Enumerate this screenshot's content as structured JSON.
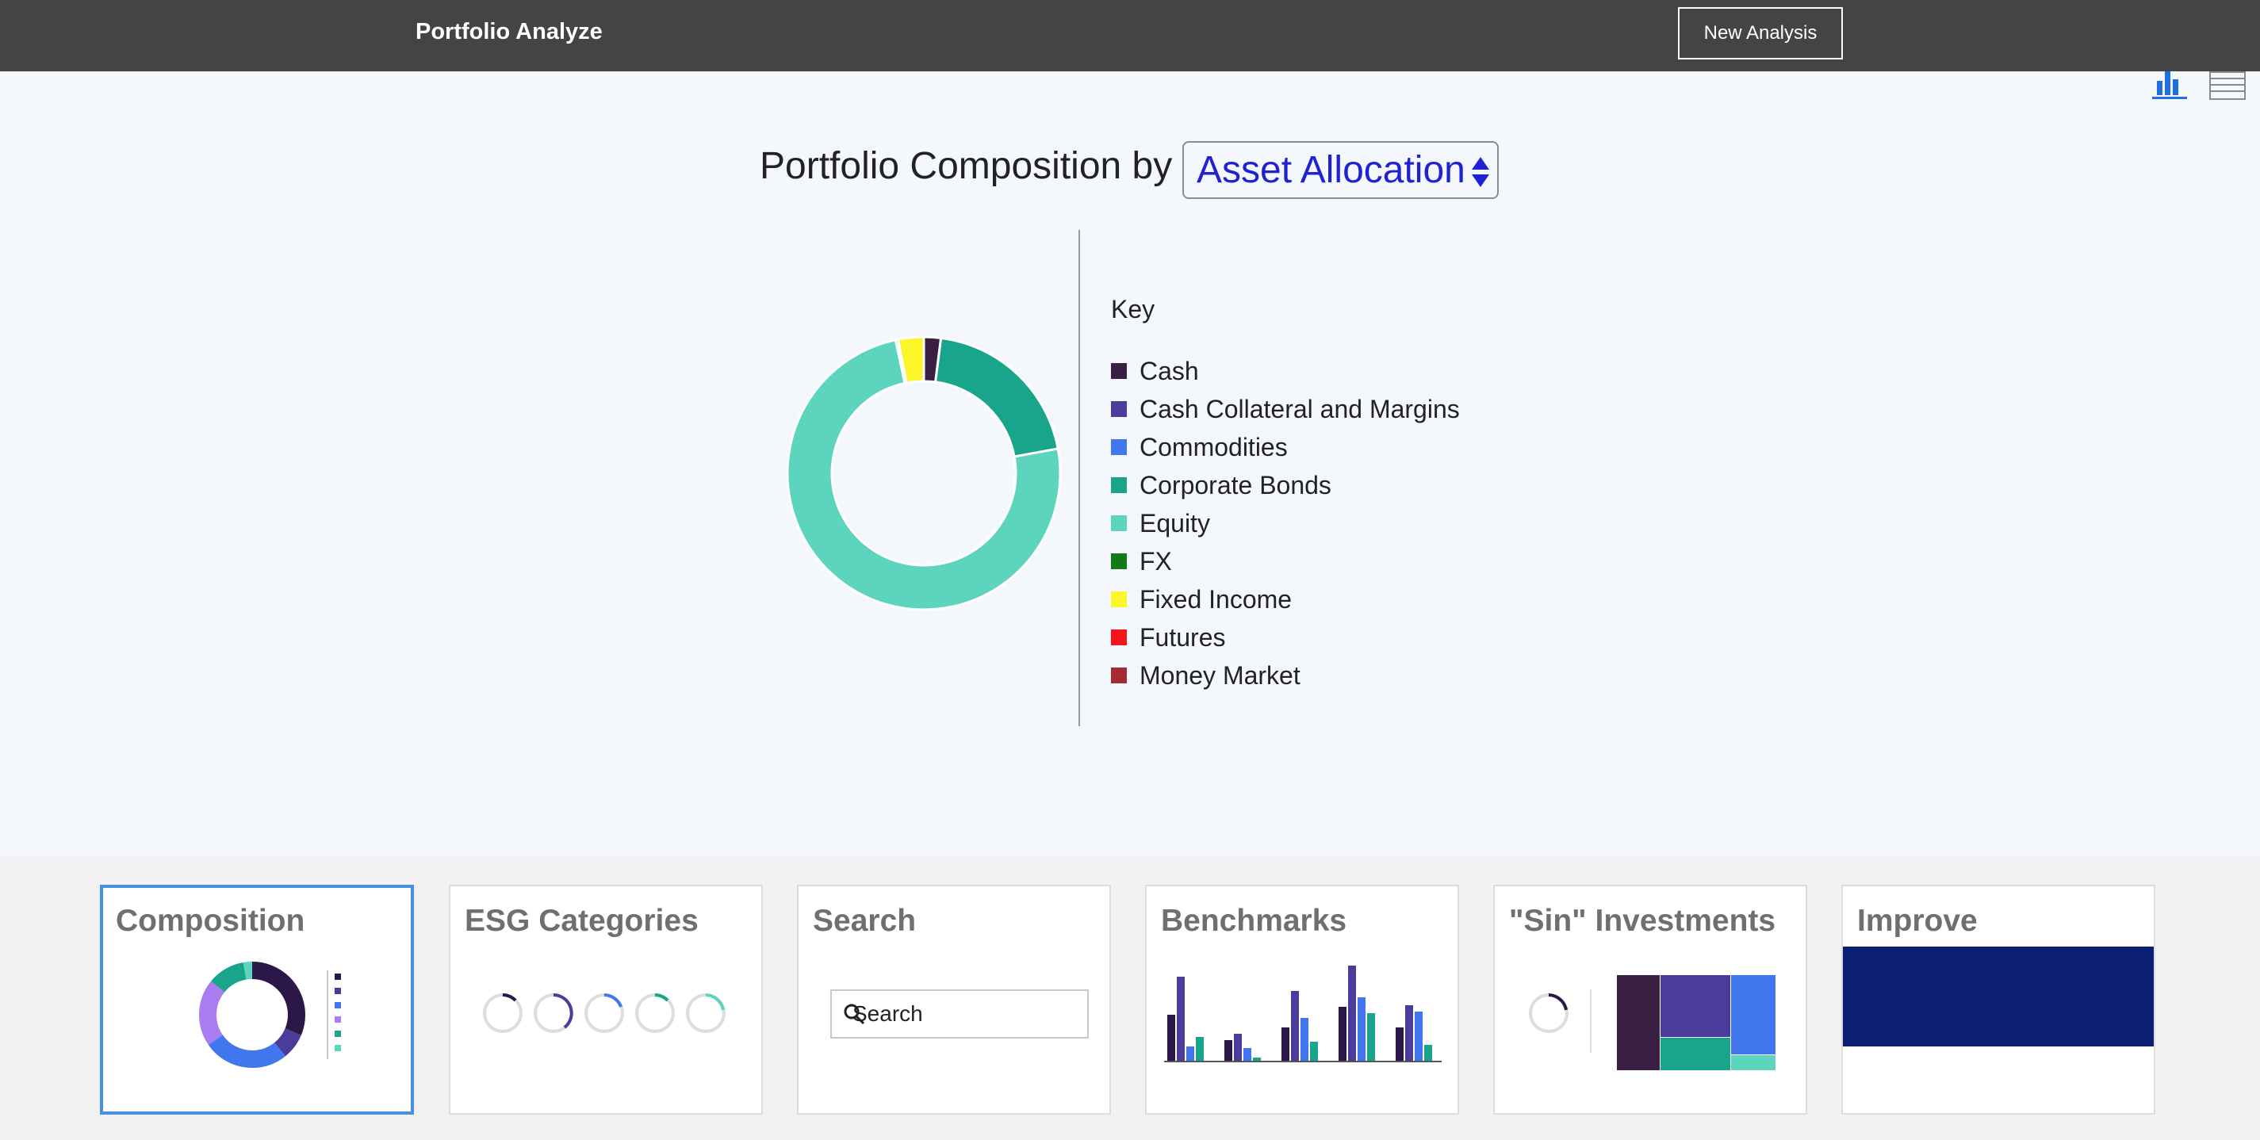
{
  "header": {
    "app_title": "Portfolio Analyze",
    "new_analysis_label": "New Analysis"
  },
  "view_toggle": {
    "chart_icon": "bar-chart-icon",
    "table_icon": "table-list-icon",
    "active": "chart"
  },
  "main": {
    "heading": "Portfolio Composition by",
    "selector_value": "Asset Allocation",
    "key_title": "Key"
  },
  "legend": [
    {
      "label": "Cash",
      "color": "#3a1f44"
    },
    {
      "label": "Cash Collateral and Margins",
      "color": "#4b3c9c"
    },
    {
      "label": "Commodities",
      "color": "#4176ee"
    },
    {
      "label": "Corporate Bonds",
      "color": "#18a58c"
    },
    {
      "label": "Equity",
      "color": "#5dd4bd"
    },
    {
      "label": "FX",
      "color": "#0f7a17"
    },
    {
      "label": "Fixed Income",
      "color": "#fbf52a"
    },
    {
      "label": "Futures",
      "color": "#f5131b"
    },
    {
      "label": "Money Market",
      "color": "#a52b32"
    }
  ],
  "chart_data": {
    "type": "pie",
    "donut": true,
    "slices": [
      {
        "label": "Cash",
        "value": 2.0,
        "color": "#3a1f44"
      },
      {
        "label": "Corporate Bonds",
        "value": 20.0,
        "color": "#18a58c"
      },
      {
        "label": "Equity",
        "value": 74.2,
        "color": "#5dd4bd"
      },
      {
        "label": "FX",
        "value": 0.3,
        "color": "#0f7a17"
      },
      {
        "label": "Fixed Income",
        "value": 3.0,
        "color": "#fbf52a"
      }
    ]
  },
  "cards": [
    {
      "title": "Composition",
      "active": true
    },
    {
      "title": "ESG Categories",
      "active": false
    },
    {
      "title": "Search",
      "active": false,
      "search_placeholder": "Search"
    },
    {
      "title": "Benchmarks",
      "active": false
    },
    {
      "title": "\"Sin\" Investments",
      "active": false
    },
    {
      "title": "Improve",
      "active": false
    }
  ]
}
